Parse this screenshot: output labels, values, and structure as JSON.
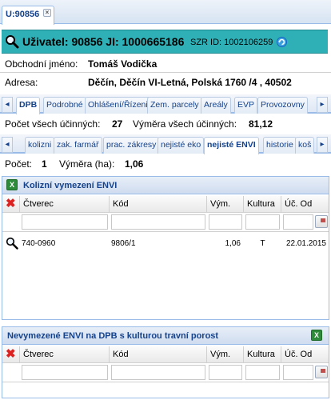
{
  "tabs": {
    "doc_tab_label": "U:90856",
    "close_glyph": "×"
  },
  "header": {
    "title": "Uživatel: 90856 JI: 1000665186",
    "szr": "SZR ID: 1002106259",
    "icons": [
      "search-icon",
      "refresh-icon"
    ],
    "bg_color": "#2fb0b6"
  },
  "info": {
    "business_name_label": "Obchodní jméno:",
    "business_name_value": "Tomáš Vodička",
    "address_label": "Adresa:",
    "address_value": "Děčín, Děčín VI-Letná, Polská 1760 /4 , 40502"
  },
  "main_tabs": {
    "items": [
      "DPB",
      "Podrobné",
      "Ohlášení/Řízeni",
      "Zem. parcely",
      "Areály",
      "EVP",
      "Provozovny"
    ],
    "active": "DPB",
    "scroll_left": "◂",
    "scroll_right": "▸"
  },
  "summary": {
    "count_label": "Počet všech účinných:",
    "count_value": "27",
    "area_label": "Výměra všech účinných:",
    "area_value": "81,12"
  },
  "sub_tabs": {
    "items": [
      "kolizni",
      "zak. farmář",
      "prac. zákresy",
      "nejisté eko",
      "nejisté ENVI",
      "historie",
      "koš"
    ],
    "active": "nejisté ENVI",
    "scroll_left": "◂",
    "scroll_right": "▸"
  },
  "sub_summary": {
    "count_label": "Počet:",
    "count_value": "1",
    "area_label": "Výměra (ha):",
    "area_value": "1,06"
  },
  "panel1": {
    "title": "Kolizní vymezení ENVI",
    "columns": [
      "Čtverec",
      "Kód",
      "Vým.",
      "Kultura",
      "Úč. Od"
    ],
    "rows": [
      {
        "ctverec": "740-0960",
        "kod": "9806/1",
        "vym": "1,06",
        "kultura": "T",
        "uc_od": "22.01.2015"
      }
    ]
  },
  "panel2": {
    "title": "Nevymezené ENVI na DPB s kulturou travní porost",
    "columns": [
      "Čtverec",
      "Kód",
      "Vým.",
      "Kultura",
      "Úč. Od"
    ],
    "rows": []
  },
  "glyphs": {
    "delete": "✖",
    "excel": "X"
  }
}
